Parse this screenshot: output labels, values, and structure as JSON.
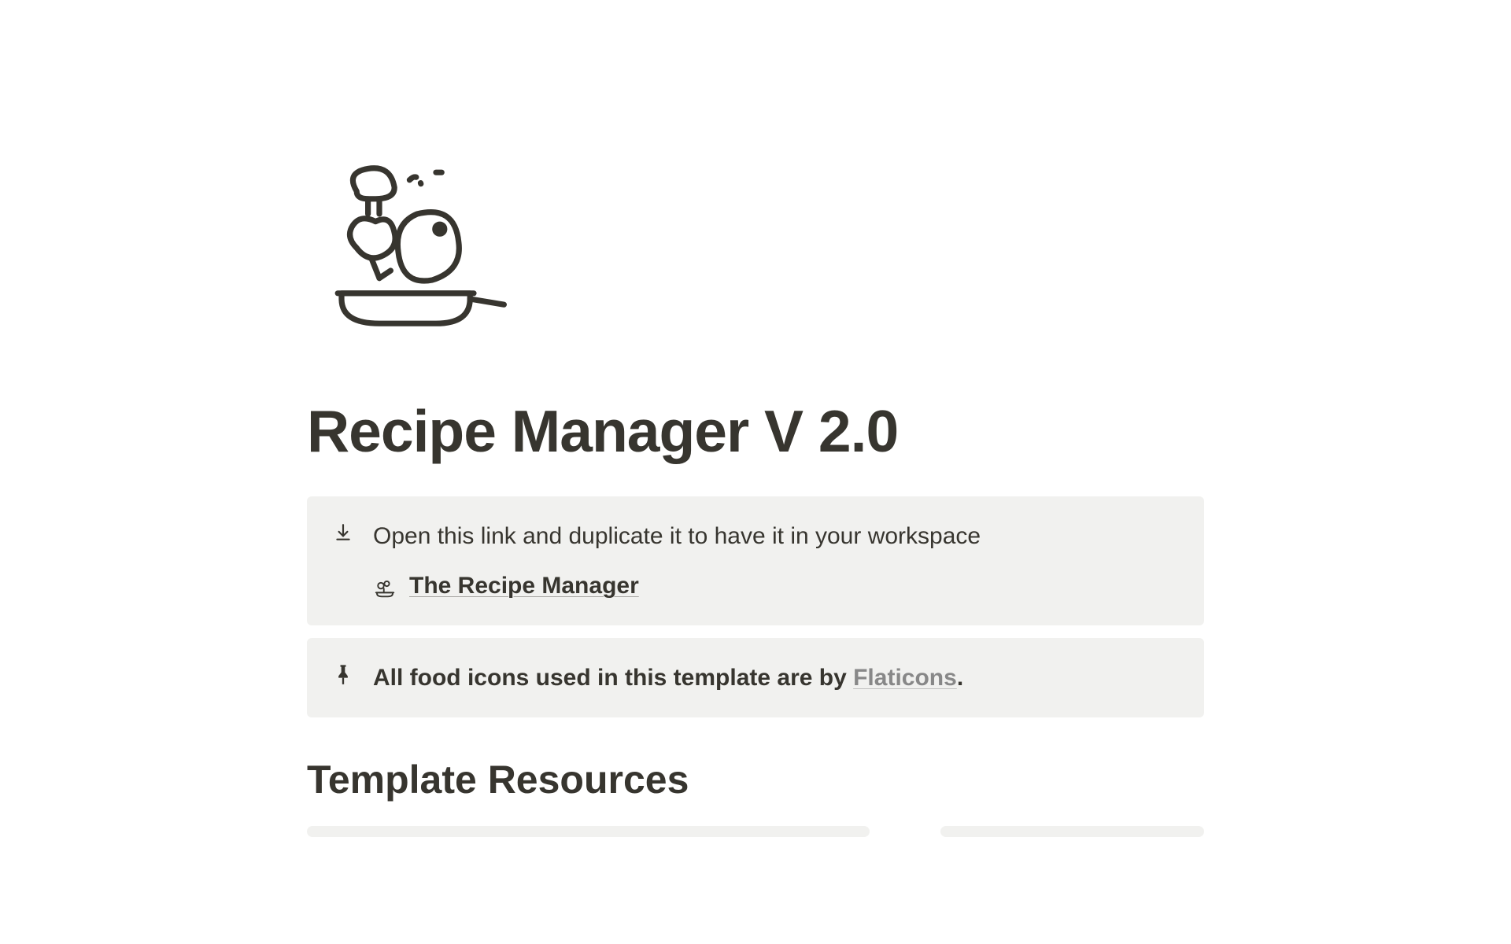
{
  "page": {
    "title": "Recipe Manager V 2.0"
  },
  "callouts": {
    "download": {
      "text": "Open this link and duplicate it to have it in your workspace",
      "link_label": "The Recipe Manager"
    },
    "attribution": {
      "prefix": "All food icons used in this template are by ",
      "link_label": "Flaticons",
      "suffix": "."
    }
  },
  "sections": {
    "resources_heading": "Template Resources"
  }
}
